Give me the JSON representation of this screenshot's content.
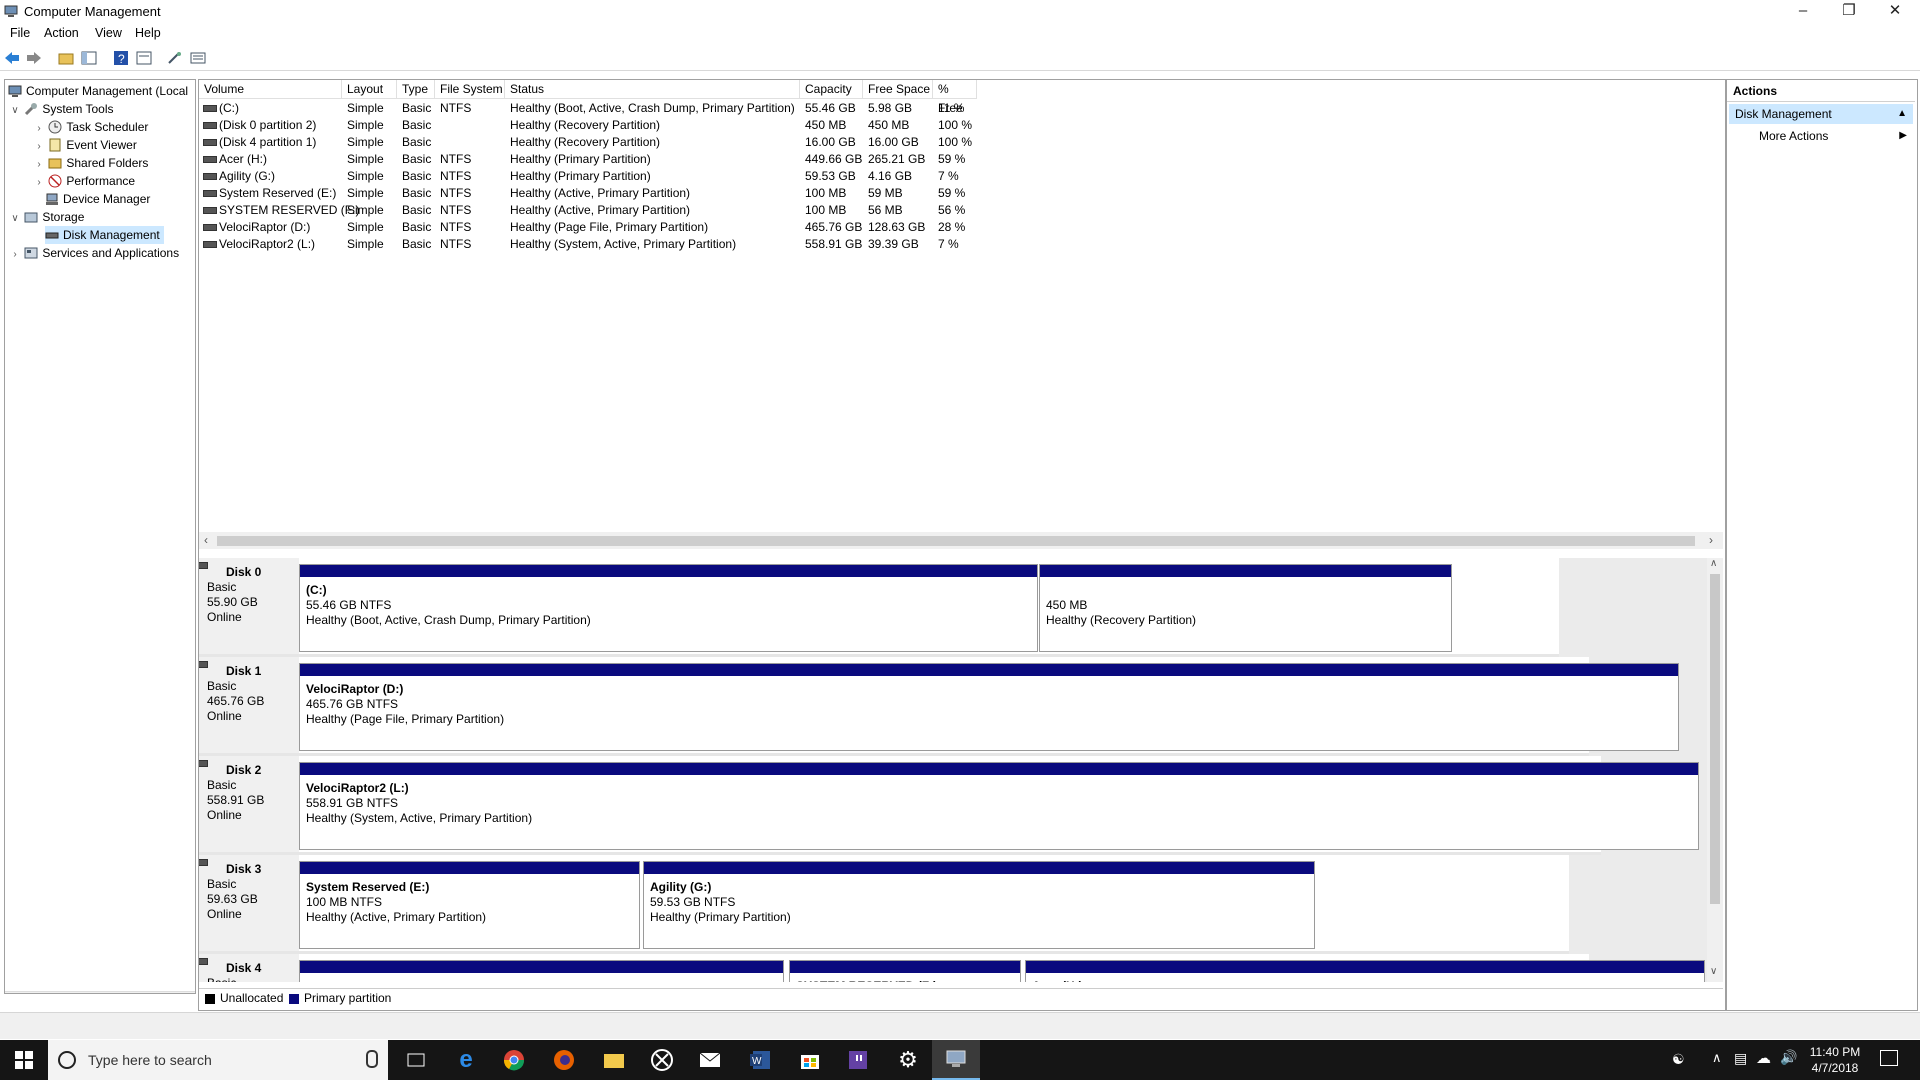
{
  "window": {
    "title": "Computer Management"
  },
  "menu": [
    "File",
    "Action",
    "View",
    "Help"
  ],
  "tree": {
    "root": "Computer Management (Local",
    "items": [
      {
        "label": "System Tools",
        "level": 1,
        "expanded": true
      },
      {
        "label": "Task Scheduler",
        "level": 2
      },
      {
        "label": "Event Viewer",
        "level": 2
      },
      {
        "label": "Shared Folders",
        "level": 2
      },
      {
        "label": "Performance",
        "level": 2
      },
      {
        "label": "Device Manager",
        "level": 2
      },
      {
        "label": "Storage",
        "level": 1,
        "expanded": true
      },
      {
        "label": "Disk Management",
        "level": 2,
        "selected": true
      },
      {
        "label": "Services and Applications",
        "level": 1
      }
    ]
  },
  "volume_list": {
    "columns": [
      "Volume",
      "Layout",
      "Type",
      "File System",
      "Status",
      "Capacity",
      "Free Space",
      "% Free"
    ],
    "rows": [
      [
        "(C:)",
        "Simple",
        "Basic",
        "NTFS",
        "Healthy (Boot, Active, Crash Dump, Primary Partition)",
        "55.46 GB",
        "5.98 GB",
        "11 %"
      ],
      [
        "(Disk 0 partition 2)",
        "Simple",
        "Basic",
        "",
        "Healthy (Recovery Partition)",
        "450 MB",
        "450 MB",
        "100 %"
      ],
      [
        "(Disk 4 partition 1)",
        "Simple",
        "Basic",
        "",
        "Healthy (Recovery Partition)",
        "16.00 GB",
        "16.00 GB",
        "100 %"
      ],
      [
        "Acer (H:)",
        "Simple",
        "Basic",
        "NTFS",
        "Healthy (Primary Partition)",
        "449.66 GB",
        "265.21 GB",
        "59 %"
      ],
      [
        "Agility (G:)",
        "Simple",
        "Basic",
        "NTFS",
        "Healthy (Primary Partition)",
        "59.53 GB",
        "4.16 GB",
        "7 %"
      ],
      [
        "System Reserved (E:)",
        "Simple",
        "Basic",
        "NTFS",
        "Healthy (Active, Primary Partition)",
        "100 MB",
        "59 MB",
        "59 %"
      ],
      [
        "SYSTEM RESERVED (F:)",
        "Simple",
        "Basic",
        "NTFS",
        "Healthy (Active, Primary Partition)",
        "100 MB",
        "56 MB",
        "56 %"
      ],
      [
        "VelociRaptor (D:)",
        "Simple",
        "Basic",
        "NTFS",
        "Healthy (Page File, Primary Partition)",
        "465.76 GB",
        "128.63 GB",
        "28 %"
      ],
      [
        "VelociRaptor2 (L:)",
        "Simple",
        "Basic",
        "NTFS",
        "Healthy (System, Active, Primary Partition)",
        "558.91 GB",
        "39.39 GB",
        "7 %"
      ]
    ]
  },
  "disks": [
    {
      "name": "Disk 0",
      "type": "Basic",
      "size": "55.90 GB",
      "state": "Online",
      "partitions": [
        {
          "label": "(C:)",
          "size": "55.46 GB NTFS",
          "status": "Healthy (Boot, Active, Crash Dump, Primary Partition)"
        },
        {
          "label": "",
          "size": "450 MB",
          "status": "Healthy (Recovery Partition)"
        }
      ]
    },
    {
      "name": "Disk 1",
      "type": "Basic",
      "size": "465.76 GB",
      "state": "Online",
      "partitions": [
        {
          "label": "VelociRaptor  (D:)",
          "size": "465.76 GB NTFS",
          "status": "Healthy (Page File, Primary Partition)"
        }
      ]
    },
    {
      "name": "Disk 2",
      "type": "Basic",
      "size": "558.91 GB",
      "state": "Online",
      "partitions": [
        {
          "label": "VelociRaptor2  (L:)",
          "size": "558.91 GB NTFS",
          "status": "Healthy (System, Active, Primary Partition)"
        }
      ]
    },
    {
      "name": "Disk 3",
      "type": "Basic",
      "size": "59.63 GB",
      "state": "Online",
      "partitions": [
        {
          "label": "System Reserved  (E:)",
          "size": "100 MB NTFS",
          "status": "Healthy (Active, Primary Partition)"
        },
        {
          "label": "Agility  (G:)",
          "size": "59.53 GB NTFS",
          "status": "Healthy (Primary Partition)"
        }
      ]
    },
    {
      "name": "Disk 4",
      "type": "Basic",
      "size": "",
      "state": "",
      "partitions": [
        {
          "label": "",
          "size": "",
          "status": ""
        },
        {
          "label": "SYSTEM RESERVED  (F:)",
          "size": "",
          "status": ""
        },
        {
          "label": "Acer  (H:)",
          "size": "",
          "status": ""
        }
      ]
    }
  ],
  "legend": {
    "unallocated": "Unallocated",
    "primary": "Primary partition"
  },
  "actions": {
    "header": "Actions",
    "section": "Disk Management",
    "more": "More Actions"
  },
  "taskbar": {
    "search_placeholder": "Type here to search",
    "time": "11:40 PM",
    "date": "4/7/2018"
  },
  "colors": {
    "partition_band": "#0a0a7e",
    "selection": "#cce8ff",
    "unallocated": "#000000"
  }
}
